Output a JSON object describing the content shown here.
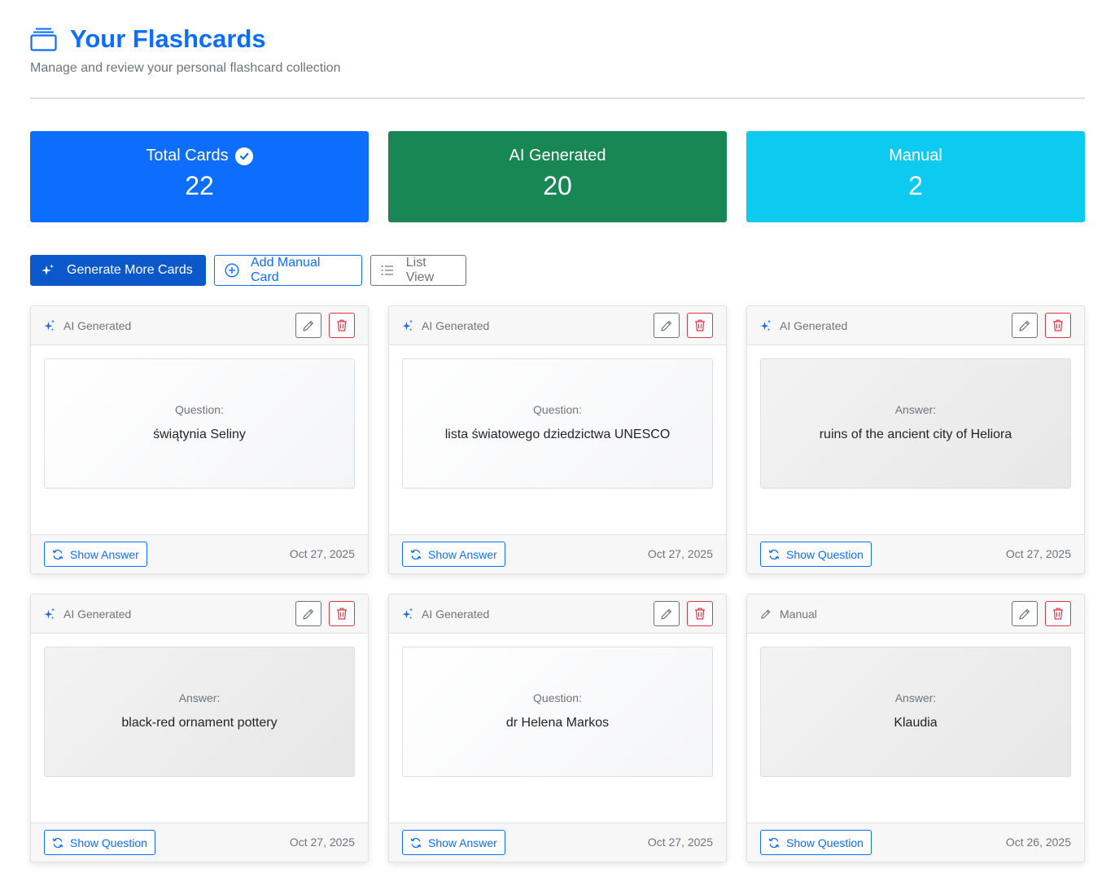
{
  "header": {
    "title": "Your Flashcards",
    "subtitle": "Manage and review your personal flashcard collection",
    "icon": "collection-icon"
  },
  "stats": {
    "total": {
      "label": "Total Cards",
      "value": "22",
      "color": "#0d6efd"
    },
    "ai": {
      "label": "AI Generated",
      "value": "20",
      "color": "#198754"
    },
    "manual": {
      "label": "Manual",
      "value": "2",
      "color": "#0dcaf0"
    }
  },
  "toolbar": {
    "generate_label": "Generate More Cards",
    "add_manual_label": "Add Manual Card",
    "list_view_label": "List View"
  },
  "cards": [
    {
      "type": "AI Generated",
      "type_icon": "stars-icon",
      "face_label": "Question:",
      "face_text": "świątynia Seliny",
      "toggle_label": "Show Answer",
      "date": "Oct 27, 2025",
      "showing": "question"
    },
    {
      "type": "AI Generated",
      "type_icon": "stars-icon",
      "face_label": "Question:",
      "face_text": "lista światowego dziedzictwa UNESCO",
      "toggle_label": "Show Answer",
      "date": "Oct 27, 2025",
      "showing": "question"
    },
    {
      "type": "AI Generated",
      "type_icon": "stars-icon",
      "face_label": "Answer:",
      "face_text": "ruins of the ancient city of Heliora",
      "toggle_label": "Show Question",
      "date": "Oct 27, 2025",
      "showing": "answer"
    },
    {
      "type": "AI Generated",
      "type_icon": "stars-icon",
      "face_label": "Answer:",
      "face_text": "black-red ornament pottery",
      "toggle_label": "Show Question",
      "date": "Oct 27, 2025",
      "showing": "answer"
    },
    {
      "type": "AI Generated",
      "type_icon": "stars-icon",
      "face_label": "Question:",
      "face_text": "dr Helena Markos",
      "toggle_label": "Show Answer",
      "date": "Oct 27, 2025",
      "showing": "question"
    },
    {
      "type": "Manual",
      "type_icon": "pencil-icon",
      "face_label": "Answer:",
      "face_text": "Klaudia",
      "toggle_label": "Show Question",
      "date": "Oct 26, 2025",
      "showing": "answer"
    }
  ]
}
